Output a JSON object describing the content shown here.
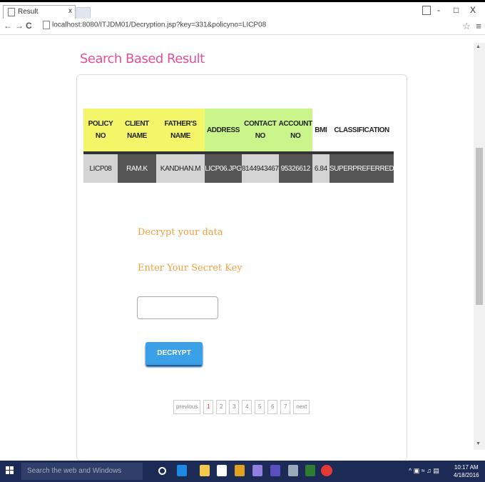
{
  "browser": {
    "tab_title": "Result",
    "tab_close": "x",
    "url": "localhost:8080/ITJDM01/Decryption.jsp?key=331&policyno=LICP08",
    "window_controls": [
      "-",
      "□",
      "X"
    ]
  },
  "page": {
    "title": "Search Based Result"
  },
  "table": {
    "headers": [
      [
        "POLICY",
        "NO"
      ],
      [
        "CLIENT",
        "NAME"
      ],
      [
        "FATHER'S",
        "NAME"
      ],
      [
        "ADDRESS"
      ],
      [
        "CONTACT",
        "NO"
      ],
      [
        "ACCOUNT",
        "NO"
      ],
      [
        "BMI"
      ],
      [
        "CLASSIFICATION"
      ]
    ],
    "row": [
      "LICP08",
      "RAM.K",
      "KANDHAN.M",
      "LICP06.JPG",
      "8144943467",
      "95326612",
      "6.84",
      "SUPERPREFERRED"
    ]
  },
  "form": {
    "heading": "Decrypt your data",
    "key_label": "Enter Your Secret Key",
    "key_value": "",
    "button": "DECRYPT"
  },
  "pagination": {
    "previous": "previous",
    "pages": [
      "1",
      "2",
      "3",
      "4",
      "5",
      "6",
      "7"
    ],
    "next": "next",
    "active": "1"
  },
  "taskbar": {
    "search_placeholder": "Search the web and Windows",
    "time": "10:17 AM",
    "date": "4/18/2016"
  }
}
